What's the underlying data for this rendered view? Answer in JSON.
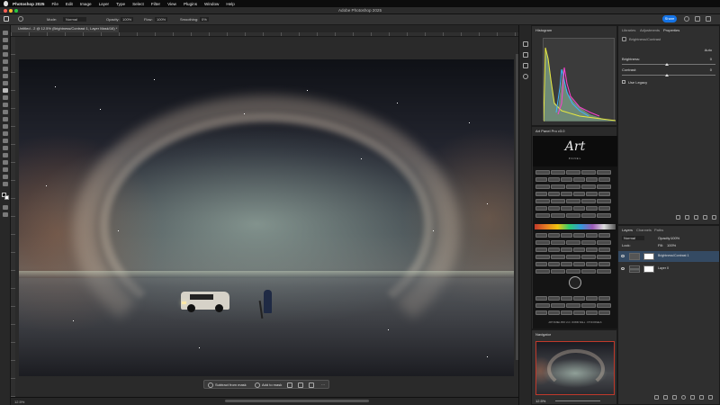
{
  "menubar": {
    "items": [
      "Photoshop 2025",
      "File",
      "Edit",
      "Image",
      "Layer",
      "Type",
      "Select",
      "Filter",
      "View",
      "Plugins",
      "Window",
      "Help"
    ]
  },
  "titlebar": {
    "title": "Adobe Photoshop 2025"
  },
  "options": {
    "mode_label": "Mode:",
    "mode_value": "Normal",
    "opacity_label": "Opacity:",
    "opacity_value": "100%",
    "flow_label": "Flow:",
    "flow_value": "100%",
    "smoothing_label": "Smoothing:",
    "smoothing_value": "0%",
    "share_label": "Share"
  },
  "document": {
    "tab_title": "Untitled - 2 @ 12.5% (Brightness/Contrast 1, Layer Mask/16) *"
  },
  "taskbar": {
    "subtract_label": "Subtract from mask",
    "add_label": "Add to mask"
  },
  "status": {
    "zoom": "12.5%"
  },
  "panels": {
    "histogram_tab": "Histogram",
    "art_tab": "Art Panel Pro v3.0",
    "art_logo": "Art",
    "art_sub": "PANEL",
    "art_footer": "ART PANEL PRO v3.0 · ROBIN WALL · KTVD PANELS",
    "navigator_tab": "Navigator",
    "navigator_zoom": "12.5%",
    "libraries_tab": "Libraries",
    "adjustments_tab": "Adjustments",
    "properties_tab": "Properties",
    "properties_title": "Brightness/Contrast",
    "auto_label": "Auto",
    "brightness_label": "Brightness:",
    "brightness_value": "0",
    "contrast_label": "Contrast:",
    "contrast_value": "0",
    "use_legacy_label": "Use Legacy",
    "layers_tab": "Layers",
    "channels_tab": "Channels",
    "paths_tab": "Paths",
    "blend_mode": "Normal",
    "layer_opacity_label": "Opacity:",
    "layer_opacity_value": "100%",
    "lock_label": "Lock:",
    "fill_label": "Fill:",
    "fill_value": "100%",
    "layers": [
      {
        "name": "Brightness/Contrast 1"
      },
      {
        "name": "Layer 0"
      }
    ]
  },
  "colors": {
    "accent": "#1473e6",
    "layer_selected": "#344a63",
    "histogram_fill": "#6e8a76"
  }
}
